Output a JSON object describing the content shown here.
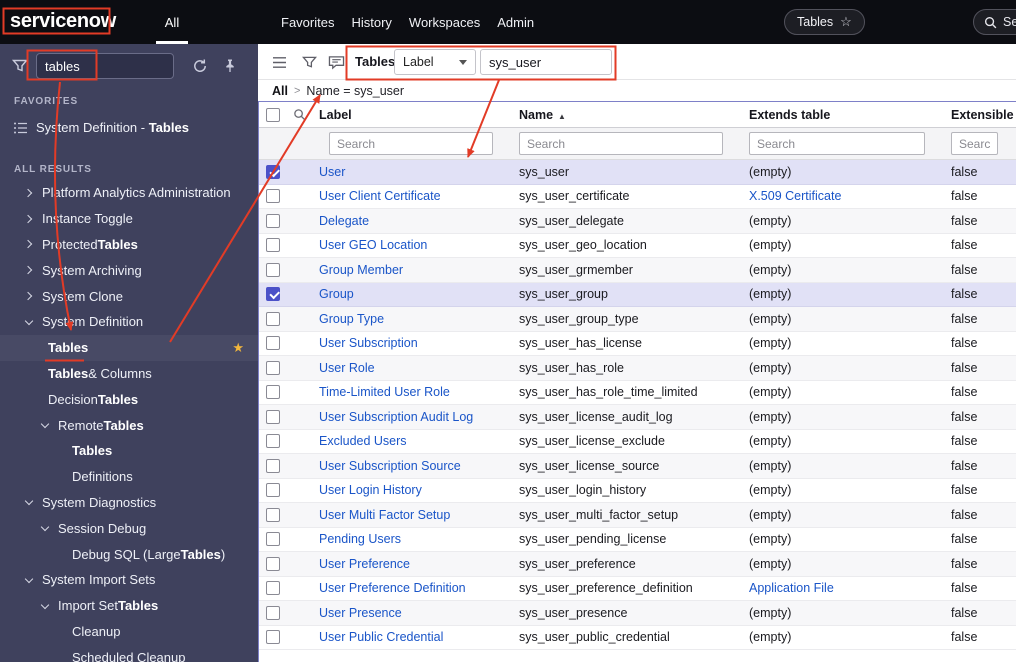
{
  "colors": {
    "annotation_red": "#e23b26",
    "link_blue": "#1a55c8",
    "selected_row_bg": "#e1e1f6",
    "checkbox_checked": "#4b51c8",
    "star_gold": "#f2b63c"
  },
  "header": {
    "logo": "servicenow",
    "all_menu": "All",
    "menus": [
      "Favorites",
      "History",
      "Workspaces",
      "Admin"
    ],
    "context_pill": "Tables",
    "context_pill_star": "☆",
    "search_text": "Sea"
  },
  "sidebar": {
    "filter_value": "tables",
    "favorites_heading": "FAVORITES",
    "favorite_item": {
      "pre": "System Definition - ",
      "bold": "Tables",
      "post": ""
    },
    "all_results_heading": "ALL RESULTS",
    "tree": [
      {
        "pre": "Platform Analytics Administration",
        "bold": "",
        "post": "",
        "level": 0,
        "chevron": "right"
      },
      {
        "pre": "Instance Toggle",
        "bold": "",
        "post": "",
        "level": 0,
        "chevron": "right"
      },
      {
        "pre": "Protected ",
        "bold": "Tables",
        "post": "",
        "level": 0,
        "chevron": "right"
      },
      {
        "pre": "System Archiving",
        "bold": "",
        "post": "",
        "level": 0,
        "chevron": "right"
      },
      {
        "pre": "System Clone",
        "bold": "",
        "post": "",
        "level": 0,
        "chevron": "right"
      },
      {
        "pre": "System Definition",
        "bold": "",
        "post": "",
        "level": 0,
        "chevron": "down"
      },
      {
        "pre": "",
        "bold": "Tables",
        "post": "",
        "level": 1,
        "selected": true,
        "starred": true
      },
      {
        "pre": "",
        "bold": "Tables",
        "post": " & Columns",
        "level": 1
      },
      {
        "pre": "Decision ",
        "bold": "Tables",
        "post": "",
        "level": 1
      },
      {
        "pre": "Remote ",
        "bold": "Tables",
        "post": "",
        "level": 1,
        "chevron": "down"
      },
      {
        "pre": "",
        "bold": "Tables",
        "post": "",
        "level": 2
      },
      {
        "pre": "Definitions",
        "bold": "",
        "post": "",
        "level": 2
      },
      {
        "pre": "System Diagnostics",
        "bold": "",
        "post": "",
        "level": 0,
        "chevron": "down"
      },
      {
        "pre": "Session Debug",
        "bold": "",
        "post": "",
        "level": 1,
        "chevron": "down"
      },
      {
        "pre": "Debug SQL (Large ",
        "bold": "Tables",
        "post": ")",
        "level": 2
      },
      {
        "pre": "System Import Sets",
        "bold": "",
        "post": "",
        "level": 0,
        "chevron": "down"
      },
      {
        "pre": "Import Set ",
        "bold": "Tables",
        "post": "",
        "level": 1,
        "chevron": "down"
      },
      {
        "pre": "Cleanup",
        "bold": "",
        "post": "",
        "level": 2
      },
      {
        "pre": "Scheduled Cleanup",
        "bold": "",
        "post": "",
        "level": 2
      }
    ]
  },
  "toolbar": {
    "title": "Tables",
    "field_selector": "Label",
    "search_value": "sys_user"
  },
  "breadcrumb": {
    "root": "All",
    "separator": ">",
    "condition": "Name = sys_user"
  },
  "list": {
    "columns": [
      "Label",
      "Name",
      "Extends table",
      "Extensible"
    ],
    "sort_indicator": "▲",
    "search_placeholder": "Search",
    "rows": [
      {
        "label": "User",
        "name": "sys_user",
        "extends": "(empty)",
        "extensible": "false",
        "selected": true
      },
      {
        "label": "User Client Certificate",
        "name": "sys_user_certificate",
        "extends": "X.509 Certificate",
        "extends_link": true,
        "extensible": "false"
      },
      {
        "label": "Delegate",
        "name": "sys_user_delegate",
        "extends": "(empty)",
        "extensible": "false"
      },
      {
        "label": "User GEO Location",
        "name": "sys_user_geo_location",
        "extends": "(empty)",
        "extensible": "false"
      },
      {
        "label": "Group Member",
        "name": "sys_user_grmember",
        "extends": "(empty)",
        "extensible": "false"
      },
      {
        "label": "Group",
        "name": "sys_user_group",
        "extends": "(empty)",
        "extensible": "false",
        "selected": true
      },
      {
        "label": "Group Type",
        "name": "sys_user_group_type",
        "extends": "(empty)",
        "extensible": "false"
      },
      {
        "label": "User Subscription",
        "name": "sys_user_has_license",
        "extends": "(empty)",
        "extensible": "false"
      },
      {
        "label": "User Role",
        "name": "sys_user_has_role",
        "extends": "(empty)",
        "extensible": "false"
      },
      {
        "label": "Time-Limited User Role",
        "name": "sys_user_has_role_time_limited",
        "extends": "(empty)",
        "extensible": "false"
      },
      {
        "label": "User Subscription Audit Log",
        "name": "sys_user_license_audit_log",
        "extends": "(empty)",
        "extensible": "false"
      },
      {
        "label": "Excluded Users",
        "name": "sys_user_license_exclude",
        "extends": "(empty)",
        "extensible": "false"
      },
      {
        "label": "User Subscription Source",
        "name": "sys_user_license_source",
        "extends": "(empty)",
        "extensible": "false"
      },
      {
        "label": "User Login History",
        "name": "sys_user_login_history",
        "extends": "(empty)",
        "extensible": "false"
      },
      {
        "label": "User Multi Factor Setup",
        "name": "sys_user_multi_factor_setup",
        "extends": "(empty)",
        "extensible": "false"
      },
      {
        "label": "Pending Users",
        "name": "sys_user_pending_license",
        "extends": "(empty)",
        "extensible": "false"
      },
      {
        "label": "User Preference",
        "name": "sys_user_preference",
        "extends": "(empty)",
        "extensible": "false"
      },
      {
        "label": "User Preference Definition",
        "name": "sys_user_preference_definition",
        "extends": "Application File",
        "extends_link": true,
        "extensible": "false"
      },
      {
        "label": "User Presence",
        "name": "sys_user_presence",
        "extends": "(empty)",
        "extensible": "false"
      },
      {
        "label": "User Public Credential",
        "name": "sys_user_public_credential",
        "extends": "(empty)",
        "extensible": "false"
      }
    ]
  }
}
